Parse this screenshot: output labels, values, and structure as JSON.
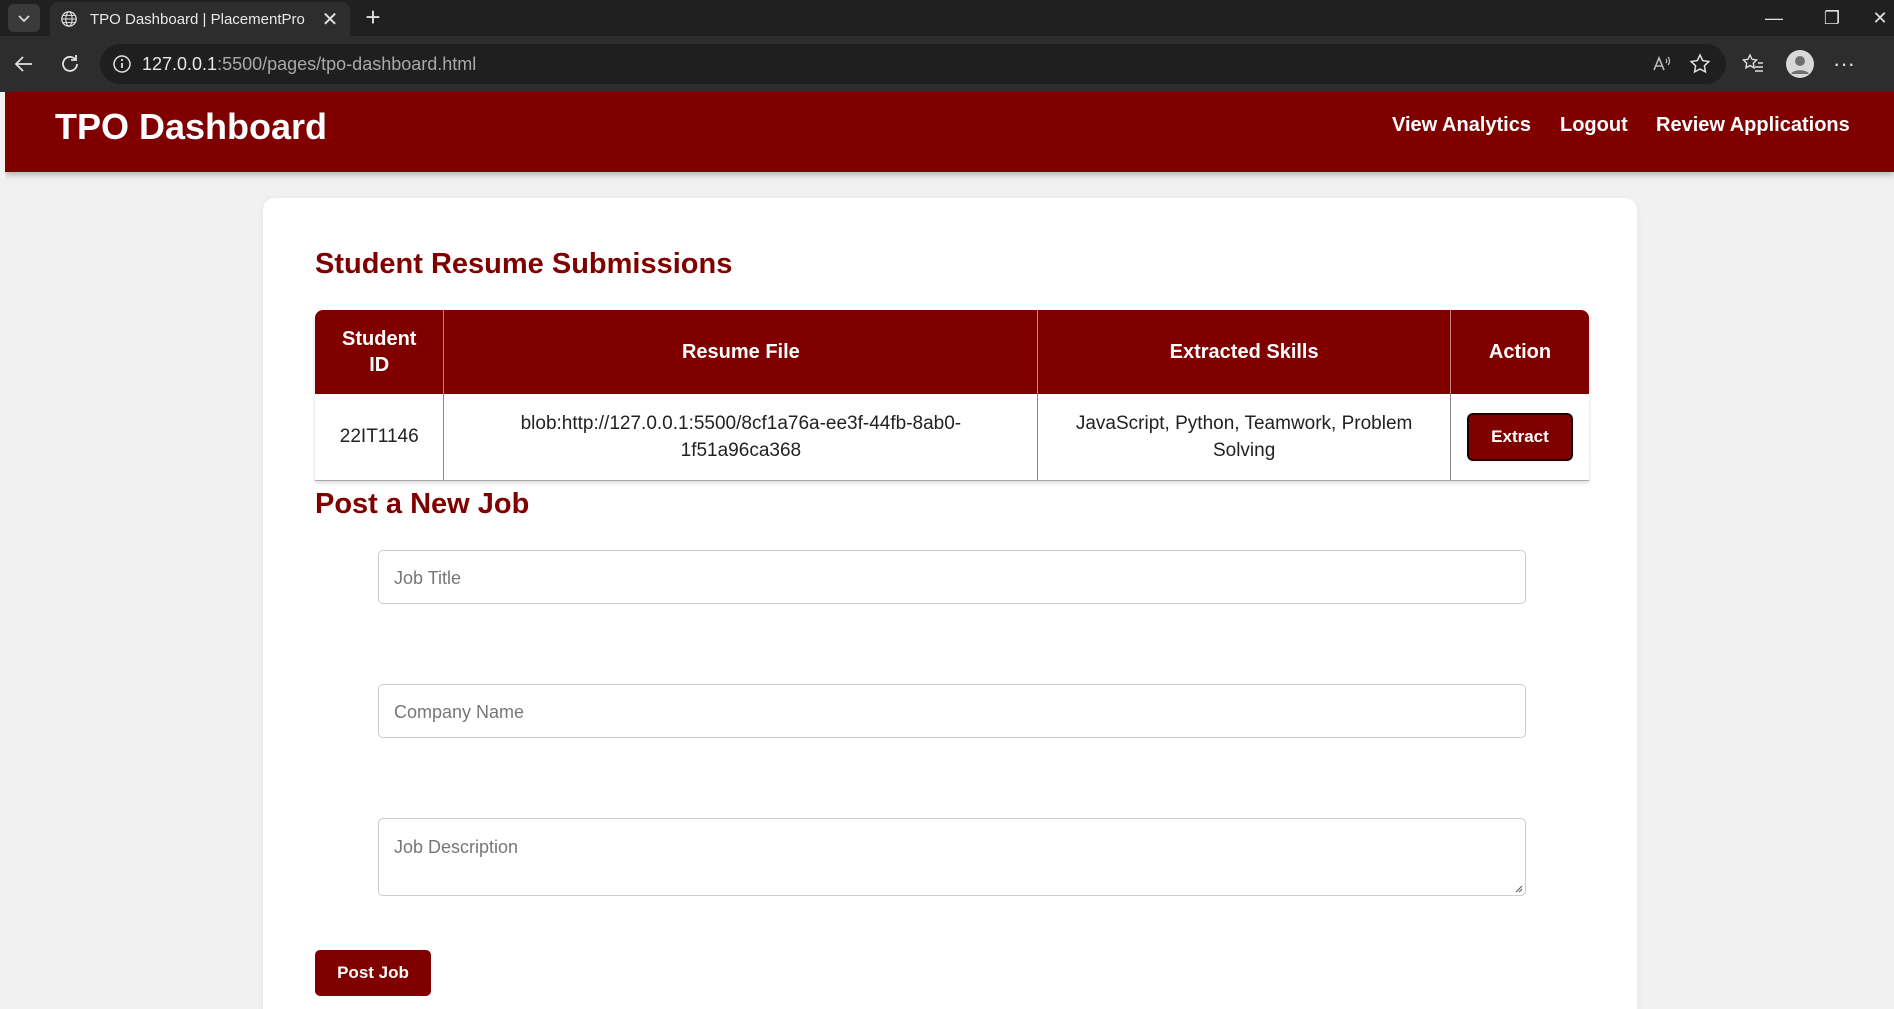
{
  "browser": {
    "tab_title": "TPO Dashboard | PlacementPro",
    "url_host": "127.0.0.1",
    "url_rest": ":5500/pages/tpo-dashboard.html"
  },
  "header": {
    "brand": "TPO Dashboard",
    "nav": [
      "View Analytics",
      "Logout",
      "Review Applications"
    ]
  },
  "resumes": {
    "title": "Student Resume Submissions",
    "columns": [
      "Student ID",
      "Resume File",
      "Extracted Skills",
      "Action"
    ],
    "rows": [
      {
        "student_id": "22IT1146",
        "resume_file": "blob:http://127.0.0.1:5500/8cf1a76a-ee3f-44fb-8ab0-1f51a96ca368",
        "skills": "JavaScript, Python, Teamwork, Problem Solving",
        "action": "Extract"
      }
    ]
  },
  "post_job": {
    "title": "Post a New Job",
    "job_title_placeholder": "Job Title",
    "company_placeholder": "Company Name",
    "description_placeholder": "Job Description",
    "submit_label": "Post Job"
  },
  "colors": {
    "brand": "#800000",
    "background": "#f1f1f1"
  }
}
